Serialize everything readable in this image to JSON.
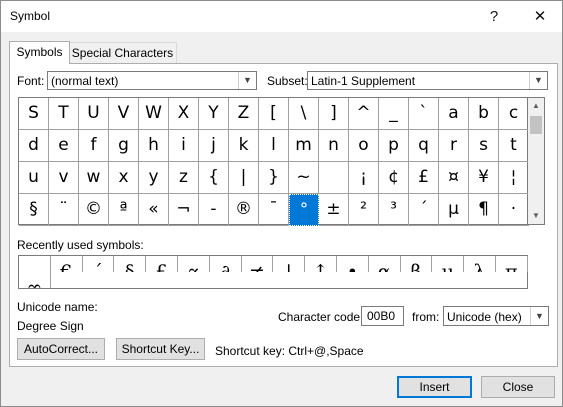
{
  "window": {
    "title": "Symbol",
    "help": "?",
    "close": "✕"
  },
  "tabs": [
    {
      "label": "Symbols",
      "active": true
    },
    {
      "label": "Special Characters",
      "active": false
    }
  ],
  "font": {
    "label": "Font:",
    "value": "(normal text)"
  },
  "subset": {
    "label": "Subset:",
    "value": "Latin-1 Supplement"
  },
  "symbols": {
    "rows": [
      [
        "S",
        "T",
        "U",
        "V",
        "W",
        "X",
        "Y",
        "Z",
        "[",
        "\\",
        "]",
        "^",
        "_",
        "`",
        "a",
        "b",
        "c"
      ],
      [
        "d",
        "e",
        "f",
        "g",
        "h",
        "i",
        "j",
        "k",
        "l",
        "m",
        "n",
        "o",
        "p",
        "q",
        "r",
        "s",
        "t"
      ],
      [
        "u",
        "v",
        "w",
        "x",
        "y",
        "z",
        "{",
        "|",
        "}",
        "~",
        "",
        "¡",
        "¢",
        "£",
        "¤",
        "¥",
        "¦"
      ],
      [
        "§",
        "¨",
        "©",
        "ª",
        "«",
        "¬",
        "-",
        "®",
        "¯",
        "°",
        "±",
        "²",
        "³",
        "´",
        "µ",
        "¶",
        "·"
      ]
    ],
    "selected": "°"
  },
  "recent": {
    "label": "Recently used symbols:",
    "items": [
      "",
      "€",
      "´",
      "§",
      "£",
      "∝",
      "∂",
      "≠",
      "↓",
      "↑",
      "•",
      "α",
      "β",
      "µ",
      "λ",
      "π",
      "∞"
    ]
  },
  "unicode_name": {
    "label": "Unicode name:",
    "value": "Degree Sign"
  },
  "char_code": {
    "label": "Character code:",
    "value": "00B0"
  },
  "from": {
    "label": "from:",
    "value": "Unicode (hex)"
  },
  "buttons": {
    "autocorrect": "AutoCorrect...",
    "shortcut_key": "Shortcut Key...",
    "insert": "Insert",
    "close": "Close"
  },
  "shortcut_text": "Shortcut key: Ctrl+@,Space",
  "icons": {
    "dropdown": "chevron-down-icon",
    "scroll_up": "scroll-up-icon",
    "scroll_down": "scroll-down-icon"
  },
  "colors": {
    "selection": "#0078d7",
    "default_button_border": "#0078d7"
  }
}
